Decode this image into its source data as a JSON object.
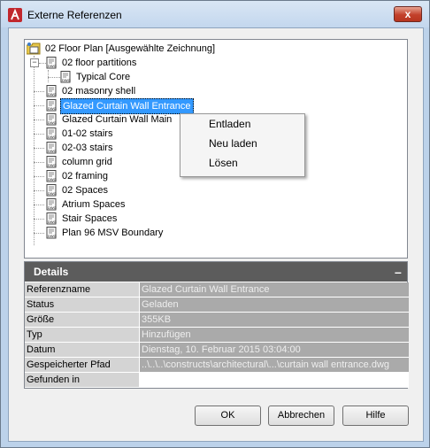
{
  "window": {
    "title": "Externe Referenzen",
    "close_label": "x"
  },
  "tree": {
    "root": "02 Floor Plan [Ausgewählte Zeichnung]",
    "items": [
      {
        "label": "02 floor partitions"
      },
      {
        "label": "Typical Core"
      },
      {
        "label": "02 masonry shell"
      },
      {
        "label": "Glazed Curtain Wall Entrance"
      },
      {
        "label": "Glazed Curtain Wall Main"
      },
      {
        "label": "01-02 stairs"
      },
      {
        "label": "02-03 stairs"
      },
      {
        "label": "column grid"
      },
      {
        "label": "02 framing"
      },
      {
        "label": "02 Spaces"
      },
      {
        "label": "Atrium Spaces"
      },
      {
        "label": "Stair Spaces"
      },
      {
        "label": "Plan 96 MSV Boundary"
      }
    ]
  },
  "context_menu": {
    "items": [
      "Entladen",
      "Neu laden",
      "Lösen"
    ]
  },
  "details": {
    "header": "Details",
    "collapse": "–",
    "rows": [
      {
        "key": "Referenzname",
        "value": "Glazed Curtain Wall Entrance"
      },
      {
        "key": "Status",
        "value": "Geladen"
      },
      {
        "key": "Größe",
        "value": "355KB"
      },
      {
        "key": "Typ",
        "value": "Hinzufügen"
      },
      {
        "key": "Datum",
        "value": "Dienstag, 10. Februar 2015  03:04:00"
      },
      {
        "key": "Gespeicherter Pfad",
        "value": "..\\..\\..\\constructs\\architectural\\...\\curtain wall entrance.dwg"
      },
      {
        "key": "Gefunden in",
        "value": ""
      }
    ]
  },
  "buttons": {
    "ok": "OK",
    "cancel": "Abbrechen",
    "help": "Hilfe"
  },
  "icons": {
    "app": "autocad-logo-icon",
    "file": "dwg-file-icon",
    "folder": "folder-drawing-icon"
  },
  "colors": {
    "selection": "#3399ff",
    "details_header": "#5c5c5c",
    "close_button": "#c2402b"
  }
}
